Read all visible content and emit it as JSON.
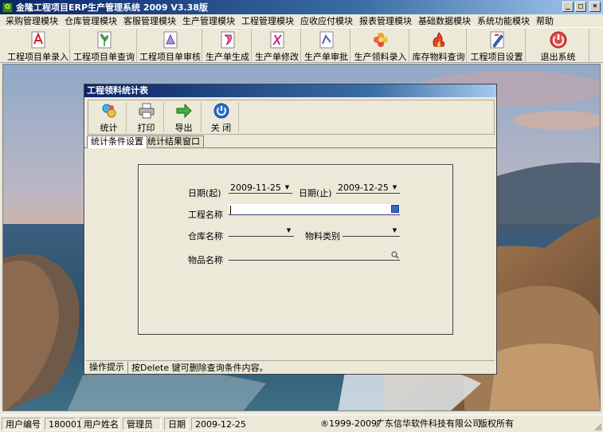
{
  "window": {
    "title": "金隆工程项目ERP生产管理系统 2009 V3.38版",
    "minimize": "_",
    "maximize": "□",
    "close": "×"
  },
  "menu": [
    "采购管理模块",
    "仓库管理模块",
    "客服管理模块",
    "生产管理模块",
    "工程管理模块",
    "应收应付模块",
    "报表管理模块",
    "基础数据模块",
    "系统功能模块",
    "帮助"
  ],
  "toolbar": [
    {
      "label": "工程项目单录入",
      "icon": "pdf-doc-icon"
    },
    {
      "label": "工程项目单查询",
      "icon": "plant-doc-icon"
    },
    {
      "label": "工程项目单审核",
      "icon": "purple-doc-icon"
    },
    {
      "label": "生产单生成",
      "icon": "pink-doc-icon"
    },
    {
      "label": "生产单修改",
      "icon": "edit-doc-icon"
    },
    {
      "label": "生产单审批",
      "icon": "approve-doc-icon"
    },
    {
      "label": "生产领料录入",
      "icon": "flower-icon"
    },
    {
      "label": "库存物料查询",
      "icon": "flame-doc-icon"
    },
    {
      "label": "工程项目设置",
      "icon": "pen-doc-icon"
    },
    {
      "label": "退出系统",
      "icon": "power-red-icon"
    }
  ],
  "child_window": {
    "title": "工程领料统计表",
    "tools": [
      {
        "label": "统计",
        "icon": "stats-icon"
      },
      {
        "label": "打印",
        "icon": "printer-icon"
      },
      {
        "label": "导出",
        "icon": "export-arrow-icon"
      },
      {
        "label": "关 闭",
        "icon": "power-blue-icon"
      }
    ],
    "tabs": [
      "统计条件设置",
      "统计结果窗口"
    ],
    "form": {
      "date_from_label": "日期(起)",
      "date_from_value": "2009-11-25",
      "date_to_label": "日期(止)",
      "date_to_value": "2009-12-25",
      "project_label": "工程名称",
      "project_value": "",
      "warehouse_label": "仓库名称",
      "warehouse_value": "",
      "category_label": "物料类别",
      "category_value": "",
      "item_label": "物品名称",
      "item_value": ""
    },
    "hint_label": "操作提示",
    "hint_text": "按Delete 键可删除查询条件内容。"
  },
  "status": {
    "user_id_label": "用户编号",
    "user_id": "180001",
    "user_name_label": "用户姓名",
    "user_name": "管理员",
    "date_label": "日期",
    "date": "2009-12-25",
    "copyright": "®1999-2009?",
    "company": "广东信华软件科技有限公司",
    "rights": "版权所有"
  }
}
